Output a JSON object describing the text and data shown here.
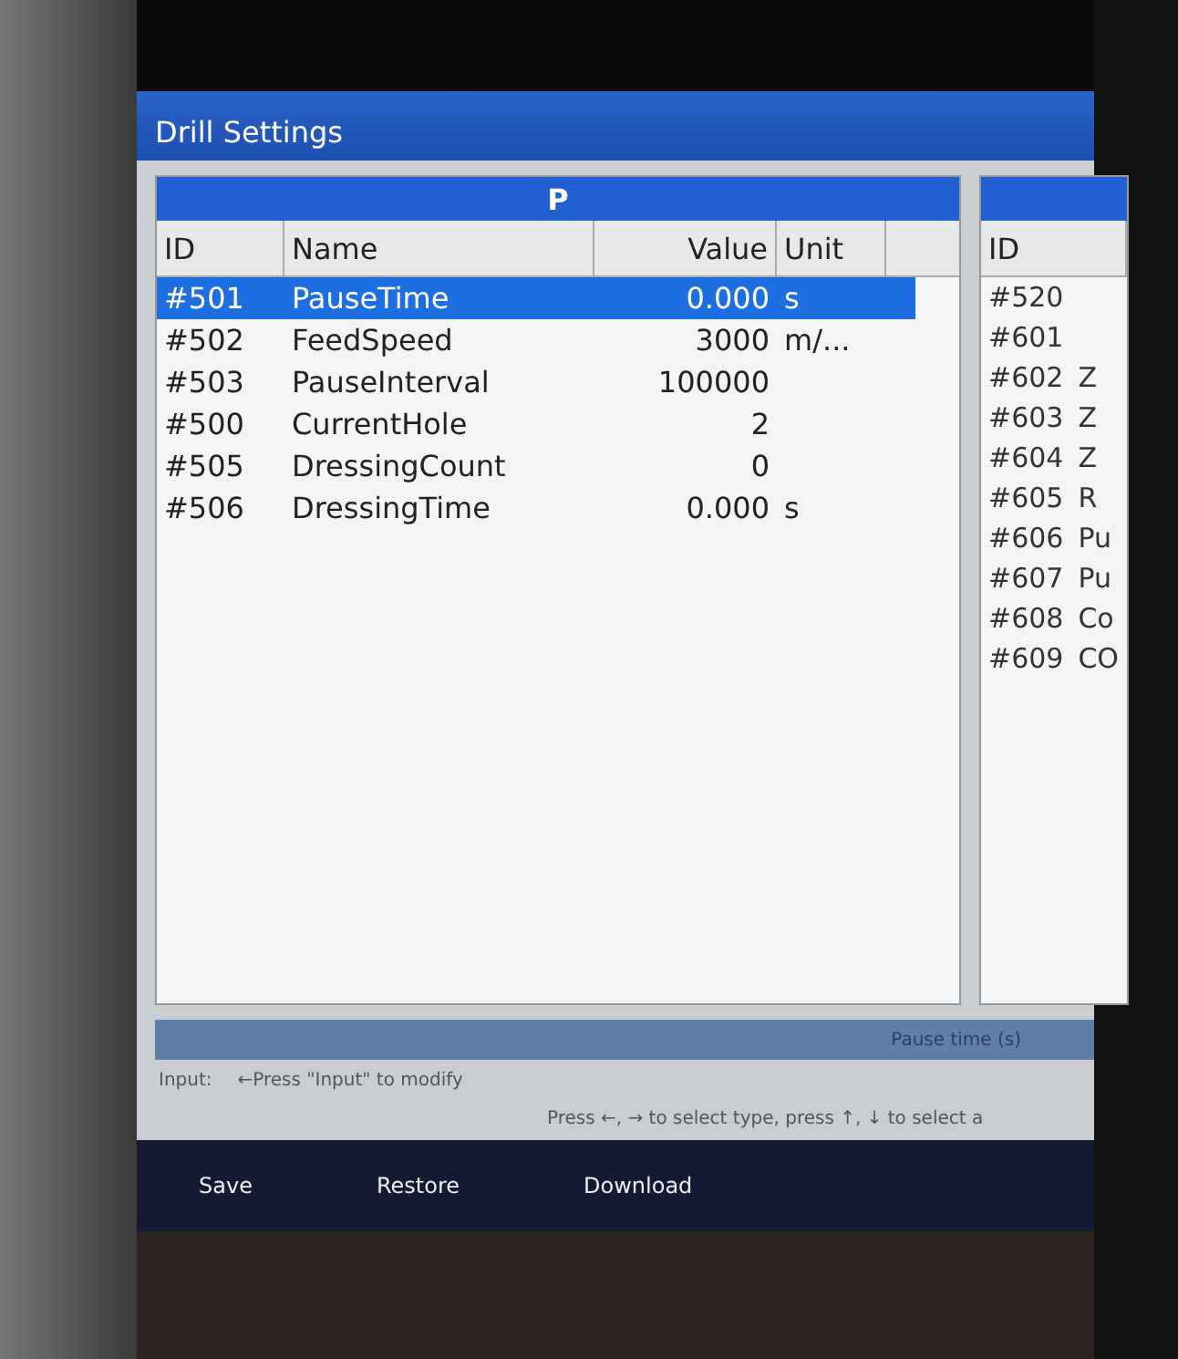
{
  "window": {
    "title": "Drill Settings"
  },
  "left_table": {
    "title": "P",
    "columns": [
      "ID",
      "Name",
      "Value",
      "Unit"
    ],
    "rows": [
      {
        "id": "#501",
        "name": "PauseTime",
        "value": "0.000",
        "unit": "s",
        "selected": true
      },
      {
        "id": "#502",
        "name": "FeedSpeed",
        "value": "3000",
        "unit": "m/...",
        "selected": false
      },
      {
        "id": "#503",
        "name": "PauseInterval",
        "value": "100000",
        "unit": "",
        "selected": false
      },
      {
        "id": "#500",
        "name": "CurrentHole",
        "value": "2",
        "unit": "",
        "selected": false
      },
      {
        "id": "#505",
        "name": "DressingCount",
        "value": "0",
        "unit": "",
        "selected": false
      },
      {
        "id": "#506",
        "name": "DressingTime",
        "value": "0.000",
        "unit": "s",
        "selected": false
      }
    ]
  },
  "right_table": {
    "columns": [
      "ID"
    ],
    "rows": [
      {
        "id": "#520",
        "name": ""
      },
      {
        "id": "#601",
        "name": ""
      },
      {
        "id": "#602",
        "name": "Z"
      },
      {
        "id": "#603",
        "name": "Z"
      },
      {
        "id": "#604",
        "name": "Z"
      },
      {
        "id": "#605",
        "name": "R"
      },
      {
        "id": "#606",
        "name": "Pu"
      },
      {
        "id": "#607",
        "name": "Pu"
      },
      {
        "id": "#608",
        "name": "Co"
      },
      {
        "id": "#609",
        "name": "CO"
      }
    ]
  },
  "status_bar": {
    "description": "Pause time (s)"
  },
  "input": {
    "label": "Input:",
    "hint": "←Press \"Input\" to modify"
  },
  "help_text": "Press ←, → to select type, press ↑, ↓ to select a",
  "buttons": [
    "Save",
    "Restore",
    "Download"
  ]
}
